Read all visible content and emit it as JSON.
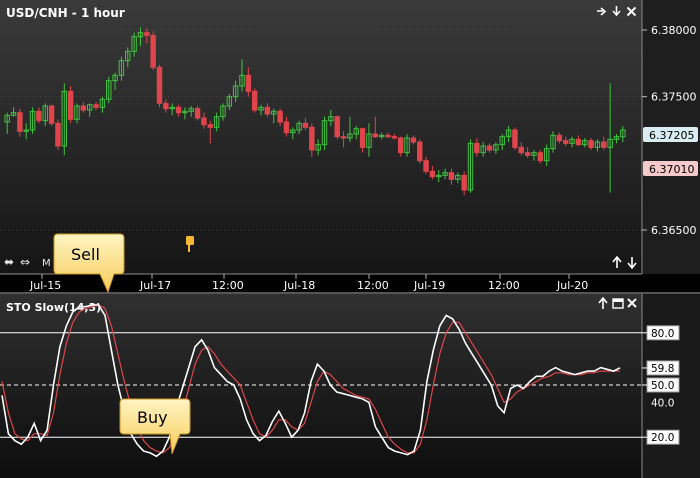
{
  "price_panel": {
    "title": "USD/CNH - 1 hour",
    "nav_arrows": [
      "⬌",
      "⇔",
      "M"
    ],
    "price_labels": [
      {
        "text": "6.38000",
        "value": 6.38
      },
      {
        "text": "6.37500",
        "value": 6.375
      },
      {
        "text": "6.36500",
        "value": 6.365
      }
    ],
    "current_bid": {
      "text": "6.37205",
      "value": 6.37205,
      "color": "#d8ecf2"
    },
    "current_ask": {
      "text": "6.37010",
      "value": 6.3701,
      "color": "#f6caca"
    },
    "time_labels": [
      "Jul-15",
      "Jul-17",
      "12:00",
      "Jul-18",
      "12:00",
      "Jul-19",
      "12:00",
      "Jul-20"
    ]
  },
  "oscillator_panel": {
    "title": "STO Slow(14,3)",
    "level_labels": [
      {
        "text": "80.0",
        "value": 80,
        "boxed": true
      },
      {
        "text": "59.8",
        "value": 59.8,
        "boxed": true
      },
      {
        "text": "50.0",
        "value": 50,
        "boxed": true
      },
      {
        "text": "40.0",
        "value": 40,
        "boxed": false
      },
      {
        "text": "20.0",
        "value": 20,
        "boxed": true
      }
    ]
  },
  "callouts": {
    "sell": "Sell",
    "buy": "Buy"
  },
  "colors": {
    "up": "#3fc43f",
    "down": "#e0454b",
    "k_line": "#ffffff",
    "d_line": "#e0454b",
    "callout": "#fde08a"
  },
  "chart_data": [
    {
      "type": "candlestick",
      "title": "USD/CNH - 1 hour",
      "ylim": [
        6.3635,
        6.3815
      ],
      "x_tick_labels": [
        "Jul-15",
        "Jul-17",
        "12:00",
        "Jul-18",
        "12:00",
        "Jul-19",
        "12:00",
        "Jul-20"
      ],
      "y_tick_labels": [
        "6.38000",
        "6.37500",
        "6.36500"
      ],
      "candles": [
        [
          6.3731,
          6.3738,
          6.3722,
          6.3736
        ],
        [
          6.3736,
          6.3742,
          6.3735,
          6.3738
        ],
        [
          6.3738,
          6.3741,
          6.372,
          6.3724
        ],
        [
          6.3724,
          6.373,
          6.3718,
          6.3725
        ],
        [
          6.3725,
          6.3742,
          6.3722,
          6.3739
        ],
        [
          6.3739,
          6.3742,
          6.373,
          6.3732
        ],
        [
          6.3732,
          6.3745,
          6.3728,
          6.3743
        ],
        [
          6.3743,
          6.3744,
          6.3728,
          6.373
        ],
        [
          6.373,
          6.3733,
          6.371,
          6.3713
        ],
        [
          6.3713,
          6.376,
          6.3706,
          6.3754
        ],
        [
          6.3754,
          6.3758,
          6.373,
          6.3733
        ],
        [
          6.3733,
          6.3745,
          6.373,
          6.3743
        ],
        [
          6.3743,
          6.3746,
          6.3738,
          6.374
        ],
        [
          6.374,
          6.3745,
          6.3735,
          6.3744
        ],
        [
          6.3744,
          6.3746,
          6.374,
          6.3742
        ],
        [
          6.3742,
          6.375,
          6.3738,
          6.3748
        ],
        [
          6.3748,
          6.3765,
          6.3745,
          6.3762
        ],
        [
          6.3762,
          6.3768,
          6.3755,
          6.3766
        ],
        [
          6.3766,
          6.378,
          6.3762,
          6.3777
        ],
        [
          6.3777,
          6.3787,
          6.3772,
          6.3784
        ],
        [
          6.3784,
          6.3798,
          6.378,
          6.3795
        ],
        [
          6.3795,
          6.3802,
          6.3788,
          6.3798
        ],
        [
          6.3798,
          6.3801,
          6.379,
          6.3796
        ],
        [
          6.3796,
          6.3799,
          6.377,
          6.3772
        ],
        [
          6.3772,
          6.3774,
          6.3742,
          6.3745
        ],
        [
          6.3745,
          6.3748,
          6.3738,
          6.3741
        ],
        [
          6.3741,
          6.3745,
          6.3736,
          6.3742
        ],
        [
          6.3742,
          6.3744,
          6.3735,
          6.3738
        ],
        [
          6.3738,
          6.3742,
          6.3733,
          6.3739
        ],
        [
          6.3739,
          6.3743,
          6.3735,
          6.3741
        ],
        [
          6.3741,
          6.3743,
          6.3732,
          6.3734
        ],
        [
          6.3734,
          6.3738,
          6.3726,
          6.3729
        ],
        [
          6.3729,
          6.3732,
          6.3715,
          6.3727
        ],
        [
          6.3727,
          6.3738,
          6.3724,
          6.3735
        ],
        [
          6.3735,
          6.3745,
          6.3732,
          6.3743
        ],
        [
          6.3743,
          6.3752,
          6.374,
          6.375
        ],
        [
          6.375,
          6.3762,
          6.3746,
          6.3758
        ],
        [
          6.3758,
          6.3778,
          6.3754,
          6.3766
        ],
        [
          6.3766,
          6.3772,
          6.375,
          6.3754
        ],
        [
          6.3754,
          6.3756,
          6.3738,
          6.374
        ],
        [
          6.374,
          6.3744,
          6.3736,
          6.3742
        ],
        [
          6.3742,
          6.3745,
          6.3735,
          6.3737
        ],
        [
          6.3737,
          6.3741,
          6.373,
          6.3739
        ],
        [
          6.3739,
          6.3741,
          6.3728,
          6.3731
        ],
        [
          6.3731,
          6.3735,
          6.372,
          6.3723
        ],
        [
          6.3723,
          6.3727,
          6.3718,
          6.3725
        ],
        [
          6.3725,
          6.3732,
          6.3722,
          6.373
        ],
        [
          6.373,
          6.3734,
          6.3725,
          6.3727
        ],
        [
          6.3727,
          6.373,
          6.3705,
          6.371
        ],
        [
          6.371,
          6.3718,
          6.3706,
          6.3714
        ],
        [
          6.3714,
          6.3735,
          6.371,
          6.3732
        ],
        [
          6.3732,
          6.374,
          6.3728,
          6.3735
        ],
        [
          6.3735,
          6.3736,
          6.3718,
          6.372
        ],
        [
          6.372,
          6.3724,
          6.3712,
          6.3719
        ],
        [
          6.3719,
          6.3735,
          6.3716,
          6.3722
        ],
        [
          6.3722,
          6.3728,
          6.3718,
          6.3726
        ],
        [
          6.3726,
          6.3727,
          6.3708,
          6.3712
        ],
        [
          6.3712,
          6.373,
          6.3705,
          6.3722
        ],
        [
          6.3722,
          6.3735,
          6.3719,
          6.372
        ],
        [
          6.372,
          6.3723,
          6.3718,
          6.3721
        ],
        [
          6.3721,
          6.3723,
          6.3719,
          6.372
        ],
        [
          6.372,
          6.3722,
          6.3718,
          6.3719
        ],
        [
          6.3719,
          6.372,
          6.3705,
          6.3708
        ],
        [
          6.3708,
          6.3722,
          6.3705,
          6.3719
        ],
        [
          6.3719,
          6.3721,
          6.3714,
          6.3716
        ],
        [
          6.3716,
          6.3718,
          6.37,
          6.3702
        ],
        [
          6.3702,
          6.3705,
          6.3692,
          6.3694
        ],
        [
          6.3694,
          6.3698,
          6.3688,
          6.369
        ],
        [
          6.369,
          6.3695,
          6.3686,
          6.3691
        ],
        [
          6.3691,
          6.3696,
          6.3688,
          6.3693
        ],
        [
          6.3693,
          6.3696,
          6.3684,
          6.3688
        ],
        [
          6.3688,
          6.3693,
          6.3685,
          6.3691
        ],
        [
          6.3691,
          6.3694,
          6.3676,
          6.368
        ],
        [
          6.368,
          6.3718,
          6.3678,
          6.3715
        ],
        [
          6.3715,
          6.3719,
          6.3705,
          6.3708
        ],
        [
          6.3708,
          6.3716,
          6.3705,
          6.3713
        ],
        [
          6.3713,
          6.3715,
          6.3708,
          6.371
        ],
        [
          6.371,
          6.3716,
          6.3707,
          6.3714
        ],
        [
          6.3714,
          6.3722,
          6.371,
          6.372
        ],
        [
          6.372,
          6.3728,
          6.3716,
          6.3725
        ],
        [
          6.3725,
          6.3727,
          6.371,
          6.3712
        ],
        [
          6.3712,
          6.3716,
          6.3706,
          6.3708
        ],
        [
          6.3708,
          6.3712,
          6.3704,
          6.3706
        ],
        [
          6.3706,
          6.371,
          6.3702,
          6.3708
        ],
        [
          6.3708,
          6.371,
          6.37,
          6.3702
        ],
        [
          6.3702,
          6.3714,
          6.3698,
          6.3711
        ],
        [
          6.3711,
          6.3724,
          6.3708,
          6.3721
        ],
        [
          6.3721,
          6.3723,
          6.3715,
          6.3717
        ],
        [
          6.3717,
          6.372,
          6.3713,
          6.3715
        ],
        [
          6.3715,
          6.372,
          6.3712,
          6.3718
        ],
        [
          6.3718,
          6.3721,
          6.3713,
          6.3714
        ],
        [
          6.3714,
          6.3719,
          6.3712,
          6.3717
        ],
        [
          6.3717,
          6.3719,
          6.371,
          6.3712
        ],
        [
          6.3712,
          6.3718,
          6.3709,
          6.3716
        ],
        [
          6.3716,
          6.372,
          6.371,
          6.3712
        ],
        [
          6.3712,
          6.376,
          6.3678,
          6.3718
        ],
        [
          6.3718,
          6.3722,
          6.3715,
          6.372
        ],
        [
          6.372,
          6.3728,
          6.3716,
          6.3725
        ]
      ]
    },
    {
      "type": "line",
      "title": "STO Slow(14,3)",
      "ylim": [
        0,
        100
      ],
      "y_tick_labels": [
        "80.0",
        "59.8",
        "50.0",
        "40.0",
        "20.0"
      ],
      "reference_lines": [
        80,
        50,
        20
      ],
      "series": [
        {
          "name": "",
          "color": "#ffffff",
          "values": [
            44,
            22,
            18,
            16,
            20,
            28,
            18,
            24,
            50,
            72,
            84,
            92,
            95,
            95,
            96,
            96,
            90,
            70,
            50,
            35,
            22,
            16,
            12,
            11,
            9,
            12,
            20,
            36,
            48,
            60,
            72,
            76,
            70,
            60,
            56,
            52,
            50,
            42,
            30,
            22,
            18,
            21,
            29,
            35,
            28,
            20,
            24,
            34,
            52,
            62,
            58,
            50,
            46,
            45,
            44,
            43,
            42,
            40,
            26,
            20,
            14,
            12,
            11,
            10,
            12,
            24,
            52,
            70,
            84,
            90,
            88,
            82,
            74,
            68,
            62,
            56,
            50,
            38,
            34,
            48,
            50,
            48,
            52,
            55,
            55,
            58,
            60,
            58,
            57,
            56,
            57,
            58,
            58,
            60,
            59,
            58,
            59.8
          ]
        },
        {
          "name": "",
          "color": "#e0454b",
          "values": [
            52,
            34,
            22,
            19,
            18,
            22,
            22,
            21,
            34,
            56,
            74,
            86,
            92,
            94,
            95,
            96,
            94,
            84,
            68,
            52,
            38,
            26,
            18,
            14,
            12,
            11,
            14,
            22,
            34,
            48,
            62,
            70,
            72,
            68,
            62,
            58,
            54,
            50,
            40,
            30,
            22,
            20,
            24,
            30,
            30,
            26,
            24,
            28,
            40,
            52,
            58,
            56,
            52,
            48,
            46,
            44,
            43,
            42,
            36,
            28,
            20,
            16,
            13,
            11,
            11,
            16,
            30,
            50,
            68,
            80,
            86,
            86,
            80,
            74,
            68,
            62,
            56,
            48,
            40,
            42,
            46,
            48,
            50,
            52,
            54,
            55,
            57,
            57,
            56,
            56,
            56,
            57,
            57,
            58,
            58,
            58,
            58
          ]
        }
      ]
    }
  ]
}
